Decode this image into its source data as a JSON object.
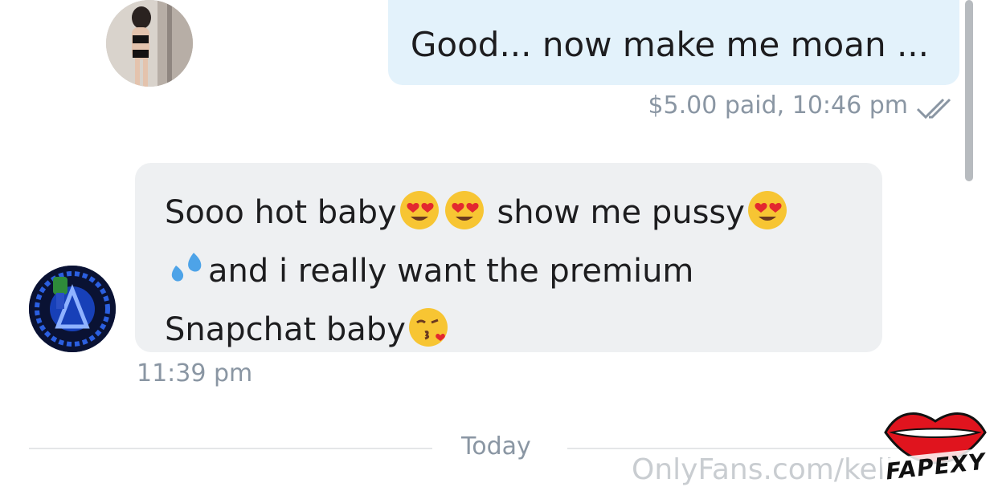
{
  "messages": {
    "outgoing": {
      "text": "Good... now make me moan ...",
      "meta": "$5.00 paid, 10:46 pm"
    },
    "incoming": {
      "line1": "Sooo hot baby",
      "line1b": "show me pussy",
      "line2": "and i really want the premium",
      "line3": "Snapchat baby",
      "time": "11:39 pm"
    }
  },
  "divider": {
    "label": "Today"
  },
  "watermark": {
    "text": "OnlyFans.com/keli"
  },
  "logo": {
    "text": "FAPEXY"
  },
  "icons": {
    "emoji_heart_eyes": "smiling-face-with-heart-eyes",
    "emoji_droplets": "sweat-droplets",
    "emoji_kiss": "face-blowing-a-kiss",
    "read_receipt": "double-check"
  },
  "colors": {
    "outgoing_bubble": "#e3f2fb",
    "incoming_bubble": "#eef0f2",
    "meta_text": "#8a96a3",
    "logo_lips": "#e0141e"
  }
}
